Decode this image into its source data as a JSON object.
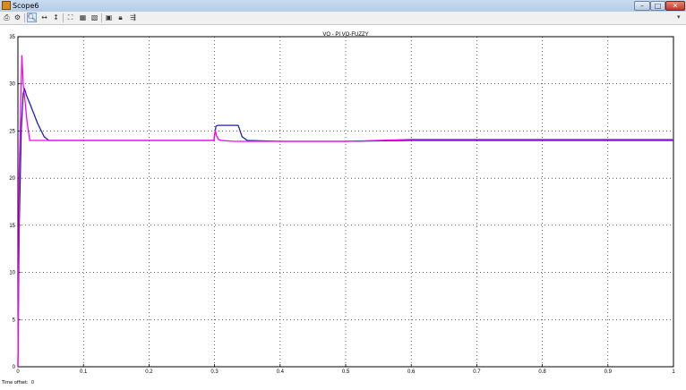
{
  "window": {
    "title": "Scope6"
  },
  "toolbar": {
    "buttons": [
      {
        "name": "print",
        "icon": "print-icon",
        "glyph": "⎙"
      },
      {
        "name": "parameters",
        "icon": "gear-icon",
        "glyph": "⚙"
      },
      {
        "name": "zoom",
        "icon": "zoom-icon",
        "glyph": "🔍︎",
        "pressed": true
      },
      {
        "name": "zoom-x",
        "icon": "zoom-x-icon",
        "glyph": "↔"
      },
      {
        "name": "zoom-y",
        "icon": "zoom-y-icon",
        "glyph": "↕"
      },
      {
        "name": "autoscale",
        "icon": "autoscale-icon",
        "glyph": "⛶"
      },
      {
        "name": "save-axes",
        "icon": "save-axes-icon",
        "glyph": "▦"
      },
      {
        "name": "restore-axes",
        "icon": "restore-axes-icon",
        "glyph": "▧"
      },
      {
        "name": "floating-scope",
        "icon": "floating-scope-icon",
        "glyph": "▣"
      },
      {
        "name": "lock-axes",
        "icon": "lock-icon",
        "glyph": "🔒︎"
      },
      {
        "name": "signal-selection",
        "icon": "signal-select-icon",
        "glyph": "⇶"
      }
    ]
  },
  "status": {
    "time_offset_label": "Time offset:",
    "time_offset_value": "0"
  },
  "colors": {
    "vo_pi": "#1f1fb4",
    "vo_fuzzy": "#ff00ff",
    "grid": "#000000",
    "axes_bg": "#ffffff"
  },
  "chart_data": {
    "type": "line",
    "title": "VO - PI   VO-FUZZY",
    "xlabel": "",
    "ylabel": "",
    "xlim": [
      0,
      1
    ],
    "ylim": [
      0,
      35
    ],
    "xticks": [
      0,
      0.1,
      0.2,
      0.3,
      0.4,
      0.5,
      0.6,
      0.7,
      0.8,
      0.9,
      1
    ],
    "xtick_labels": [
      "0",
      "0.1",
      "0.2",
      "0.3",
      "0.4",
      "0.5",
      "0.6",
      "0.7",
      "0.8",
      "0.9",
      "1"
    ],
    "yticks": [
      0,
      5,
      10,
      15,
      20,
      25,
      30,
      35
    ],
    "ytick_labels": [
      "0",
      "5",
      "10",
      "15",
      "20",
      "25",
      "30",
      "35"
    ],
    "grid": true,
    "series": [
      {
        "color": "#1f1fb4",
        "x": [
          0,
          0.002,
          0.005,
          0.008,
          0.01,
          0.013,
          0.02,
          0.03,
          0.04,
          0.047,
          0.05,
          0.1,
          0.2,
          0.299,
          0.302,
          0.305,
          0.33,
          0.336,
          0.342,
          0.35,
          0.4,
          0.5,
          0.6,
          0.7,
          0.8,
          0.9,
          1
        ],
        "y": [
          0,
          15,
          25,
          29,
          29.5,
          28.8,
          27.6,
          25.8,
          24.4,
          24,
          24,
          24,
          24,
          24,
          25.5,
          25.6,
          25.6,
          25.6,
          24.4,
          24,
          23.9,
          23.9,
          24,
          24,
          24,
          24,
          24
        ]
      },
      {
        "color": "#ff00ff",
        "x": [
          0,
          0.002,
          0.004,
          0.006,
          0.008,
          0.011,
          0.014,
          0.018,
          0.03,
          0.1,
          0.2,
          0.299,
          0.301,
          0.303,
          0.306,
          0.31,
          0.33,
          0.4,
          0.5,
          0.6,
          0.7,
          0.8,
          0.9,
          1
        ],
        "y": [
          0,
          21,
          27,
          33,
          30,
          28,
          26,
          24,
          24,
          24,
          24,
          24,
          25.1,
          24.5,
          24.1,
          24,
          23.9,
          23.9,
          23.9,
          24.1,
          24.1,
          24.1,
          24.1,
          24.1
        ]
      }
    ]
  }
}
